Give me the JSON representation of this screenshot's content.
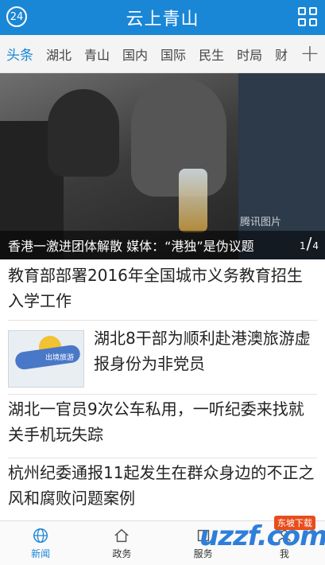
{
  "header": {
    "title": "云上青山",
    "badge": "24"
  },
  "tabs": [
    "头条",
    "湖北",
    "青山",
    "国内",
    "国际",
    "民生",
    "时局",
    "财"
  ],
  "hero": {
    "caption": "香港一激进团体解散 媒体：“港独”是伪议题",
    "watermark": "腾讯图片",
    "page_current": "1",
    "page_total": "4"
  },
  "news": [
    {
      "headline": "教育部部署2016年全国城市义务教育招生入学工作"
    },
    {
      "headline": "湖北8干部为顺利赴港澳旅游虚报身份为非党员",
      "thumb_text": "出境旅游"
    },
    {
      "headline": "湖北一官员9次公车私用，一听纪委来找就关手机玩失踪"
    },
    {
      "headline": "杭州纪委通报11起发生在群众身边的不正之风和腐败问题案例"
    }
  ],
  "bottom_nav": [
    "新闻",
    "政务",
    "服务",
    "我"
  ],
  "watermark_logo": {
    "main": "uzzf.com",
    "tag": "东坡下载"
  },
  "colors": {
    "accent": "#1a86d6"
  }
}
